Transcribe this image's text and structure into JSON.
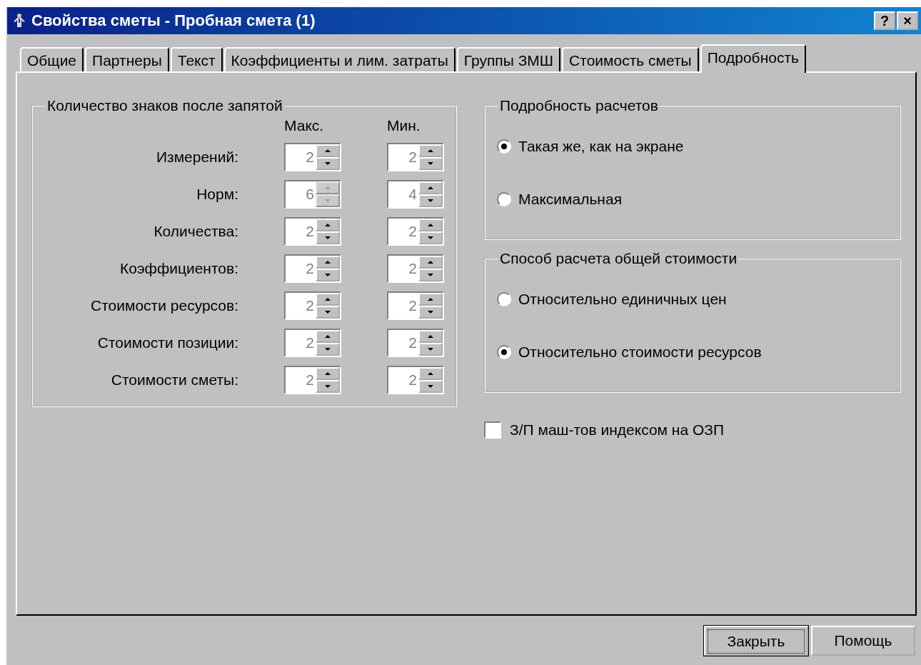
{
  "window": {
    "title": "Свойства сметы - Пробная смета (1)",
    "help_button": "?",
    "close_button": "×"
  },
  "tabs": [
    {
      "label": "Общие",
      "selected": false
    },
    {
      "label": "Партнеры",
      "selected": false
    },
    {
      "label": "Текст",
      "selected": false
    },
    {
      "label": "Коэффициенты и лим. затраты",
      "selected": false
    },
    {
      "label": "Группы ЗМШ",
      "selected": false
    },
    {
      "label": "Стоимость сметы",
      "selected": false
    },
    {
      "label": "Подробность",
      "selected": true
    }
  ],
  "decimals": {
    "title": "Количество знаков после запятой",
    "max_header": "Макс.",
    "min_header": "Мин.",
    "rows": [
      {
        "label": "Измерений:",
        "max": {
          "value": "2",
          "disabled": false
        },
        "min": {
          "value": "2",
          "disabled": false
        }
      },
      {
        "label": "Норм:",
        "max": {
          "value": "6",
          "disabled": true
        },
        "min": {
          "value": "4",
          "disabled": false
        }
      },
      {
        "label": "Количества:",
        "max": {
          "value": "2",
          "disabled": false
        },
        "min": {
          "value": "2",
          "disabled": false
        }
      },
      {
        "label": "Коэффициентов:",
        "max": {
          "value": "2",
          "disabled": false
        },
        "min": {
          "value": "2",
          "disabled": false
        }
      },
      {
        "label": "Стоимости ресурсов:",
        "max": {
          "value": "2",
          "disabled": false
        },
        "min": {
          "value": "2",
          "disabled": false
        }
      },
      {
        "label": "Стоимости позиции:",
        "max": {
          "value": "2",
          "disabled": false
        },
        "min": {
          "value": "2",
          "disabled": false
        }
      },
      {
        "label": "Стоимости сметы:",
        "max": {
          "value": "2",
          "disabled": false
        },
        "min": {
          "value": "2",
          "disabled": false
        }
      }
    ]
  },
  "detail": {
    "title": "Подробность расчетов",
    "options": [
      {
        "label": "Такая же, как на экране",
        "selected": true
      },
      {
        "label": "Максимальная",
        "selected": false
      }
    ]
  },
  "cost_method": {
    "title": "Способ расчета общей стоимости",
    "options": [
      {
        "label": "Относительно единичных цен",
        "selected": false
      },
      {
        "label": "Относительно стоимости ресурсов",
        "selected": true
      }
    ]
  },
  "machine_wage_index": {
    "label": "З/П маш-тов индексом на ОЗП",
    "checked": false
  },
  "buttons": [
    {
      "label": "Закрыть",
      "default": true
    },
    {
      "label": "Помощь",
      "default": false
    }
  ]
}
